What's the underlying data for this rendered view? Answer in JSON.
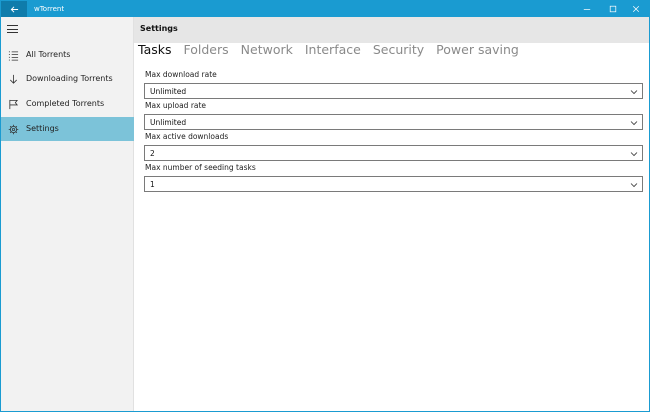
{
  "window": {
    "title": "wTorrent",
    "accent": "#1a9bd1",
    "controls": {
      "minimize": "minimize-icon",
      "maximize": "maximize-icon",
      "close": "close-icon"
    }
  },
  "sidebar": {
    "items": [
      {
        "label": "All Torrents",
        "icon": "list-icon"
      },
      {
        "label": "Downloading Torrents",
        "icon": "download-arrow-icon"
      },
      {
        "label": "Completed Torrents",
        "icon": "flag-icon"
      },
      {
        "label": "Settings",
        "icon": "gear-icon",
        "selected": true
      }
    ],
    "selected_color": "#7cc3d9"
  },
  "main": {
    "title": "Settings",
    "tabs": [
      {
        "label": "Tasks",
        "active": true
      },
      {
        "label": "Folders"
      },
      {
        "label": "Network"
      },
      {
        "label": "Interface"
      },
      {
        "label": "Security"
      },
      {
        "label": "Power saving"
      }
    ],
    "fields": [
      {
        "label": "Max download rate",
        "value": "Unlimited"
      },
      {
        "label": "Max upload rate",
        "value": "Unlimited"
      },
      {
        "label": "Max active downloads",
        "value": "2"
      },
      {
        "label": "Max number of seeding tasks",
        "value": "1"
      }
    ]
  }
}
